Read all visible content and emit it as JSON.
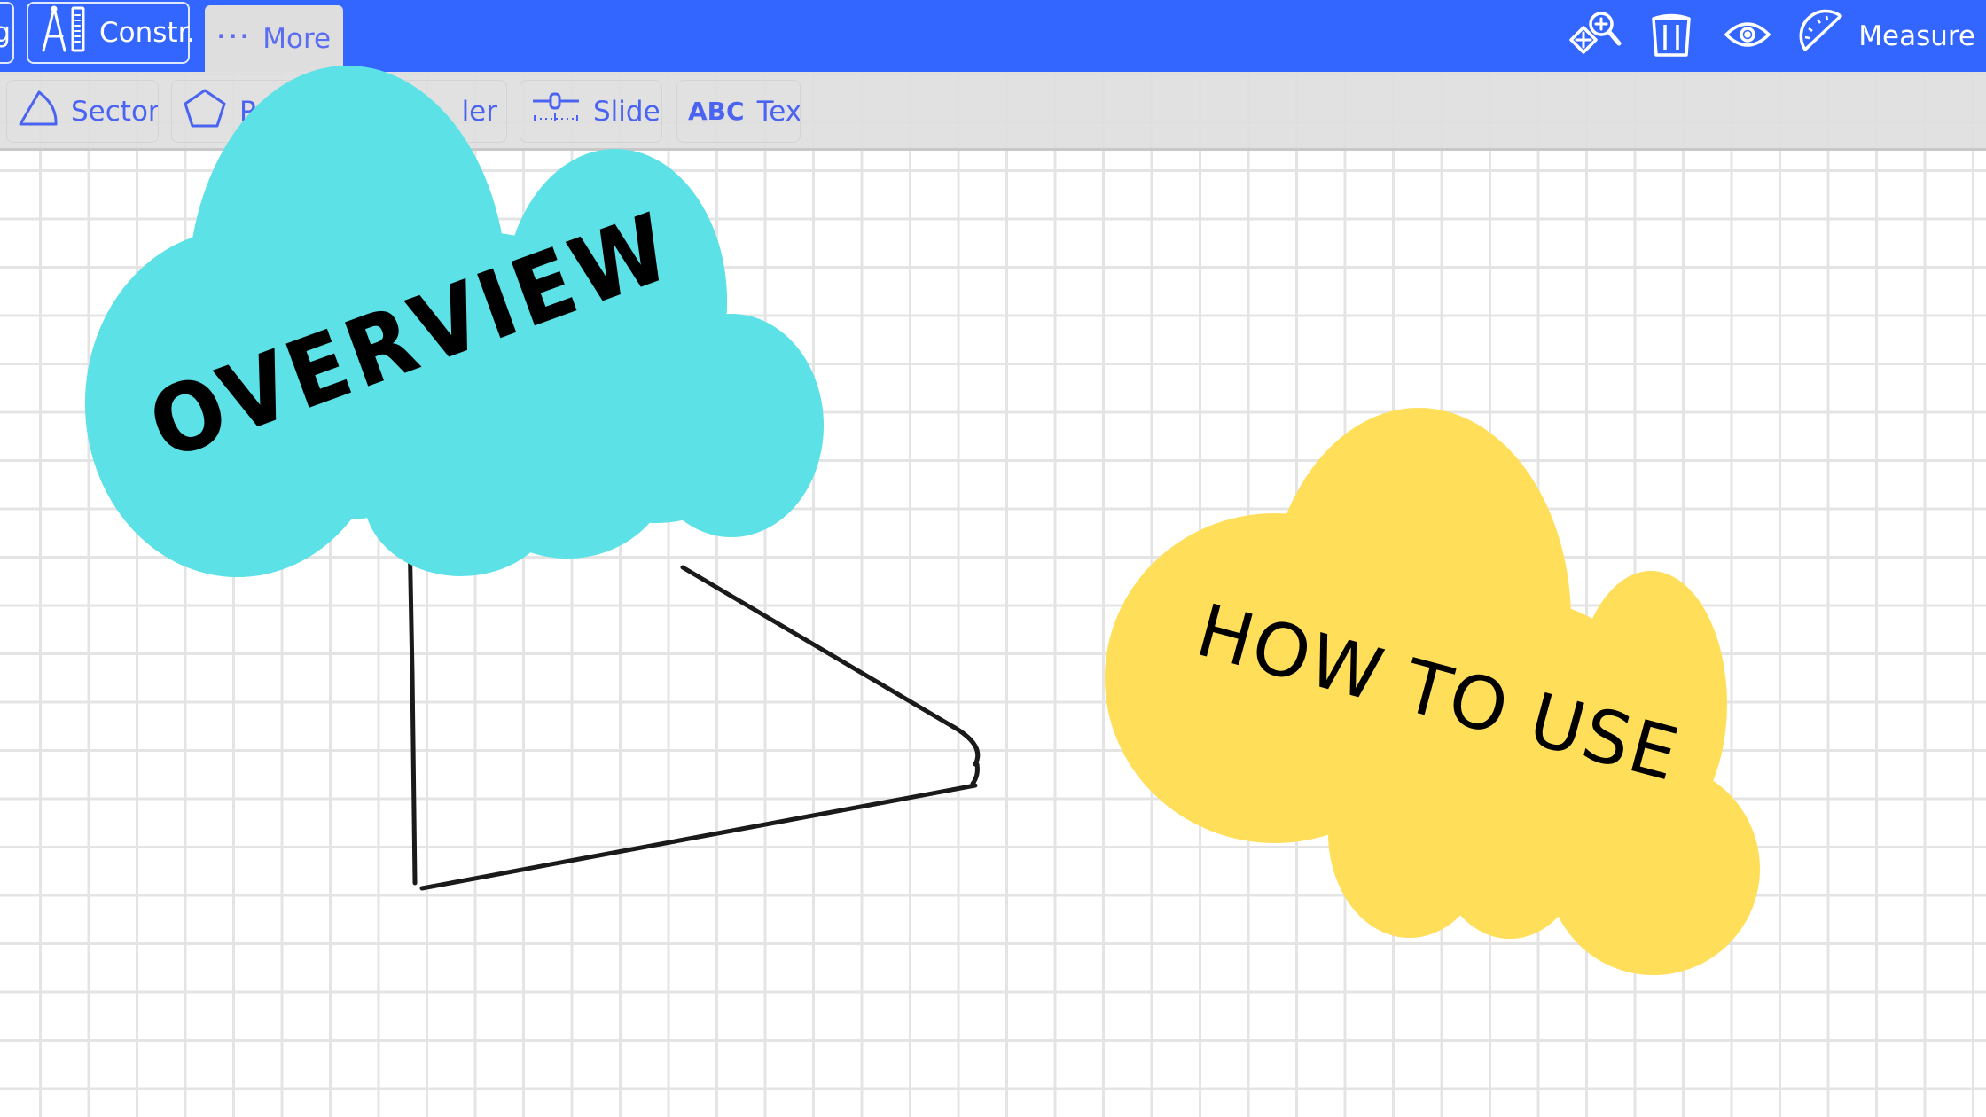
{
  "header": {
    "partial_button_label": "g",
    "construct_button_label": "Constr.",
    "more_tab_label": "More",
    "right_tools": [
      {
        "icon": "move-zoom-icon",
        "label": ""
      },
      {
        "icon": "trash-icon",
        "label": ""
      },
      {
        "icon": "eye-icon",
        "label": ""
      },
      {
        "icon": "protractor-icon",
        "label": "Measure"
      }
    ],
    "measure_label": "Measure"
  },
  "toolbar": {
    "items": [
      {
        "icon": "sector-icon",
        "label": "Sector"
      },
      {
        "icon": "polygon-icon",
        "label": "P"
      },
      {
        "icon": "ruler-icon",
        "label": "ler"
      },
      {
        "icon": "slider-icon",
        "label": "Slider"
      },
      {
        "icon": "abc-text-icon",
        "icon_text": "ABC",
        "label": "Text"
      }
    ]
  },
  "canvas": {
    "clouds": [
      {
        "name": "overview",
        "label": "OVERVIEW",
        "color": "#5ce1e6"
      },
      {
        "name": "how-to-use",
        "label": "HOW TO USE",
        "color": "#ffde59"
      }
    ],
    "stroke_color": "#1a1a1a"
  },
  "colors": {
    "header_blue": "#3366ff",
    "toolbar_gray": "#e2e2e2",
    "accent_text": "#4a63f0",
    "grid_line": "#e4e4e4"
  }
}
